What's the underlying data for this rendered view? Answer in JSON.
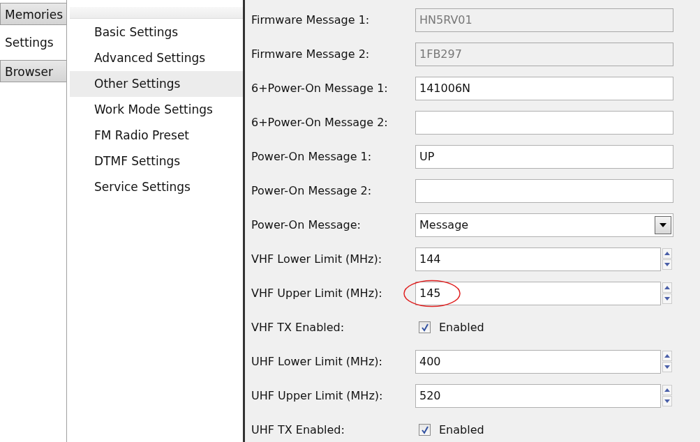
{
  "tabs": [
    {
      "label": "Memories",
      "selected": false
    },
    {
      "label": "Settings",
      "selected": true
    },
    {
      "label": "Browser",
      "selected": false
    }
  ],
  "nav": {
    "items": [
      {
        "label": "Basic Settings",
        "selected": false
      },
      {
        "label": "Advanced Settings",
        "selected": false
      },
      {
        "label": "Other Settings",
        "selected": true
      },
      {
        "label": "Work Mode Settings",
        "selected": false
      },
      {
        "label": "FM Radio Preset",
        "selected": false
      },
      {
        "label": "DTMF Settings",
        "selected": false
      },
      {
        "label": "Service Settings",
        "selected": false
      }
    ]
  },
  "form": {
    "rows": [
      {
        "kind": "text",
        "label": "Firmware Message 1:",
        "value": "HN5RV01",
        "disabled": true
      },
      {
        "kind": "text",
        "label": "Firmware Message 2:",
        "value": "1FB297",
        "disabled": true
      },
      {
        "kind": "text",
        "label": "6+Power-On Message 1:",
        "value": "141006N",
        "disabled": false
      },
      {
        "kind": "text",
        "label": "6+Power-On Message 2:",
        "value": "",
        "disabled": false
      },
      {
        "kind": "text",
        "label": "Power-On Message 1:",
        "value": "UP",
        "disabled": false
      },
      {
        "kind": "text",
        "label": "Power-On Message 2:",
        "value": "",
        "disabled": false
      },
      {
        "kind": "combo",
        "label": "Power-On Message:",
        "value": "Message"
      },
      {
        "kind": "spin",
        "label": "VHF Lower Limit (MHz):",
        "value": "144",
        "circled": false
      },
      {
        "kind": "spin",
        "label": "VHF Upper Limit (MHz):",
        "value": "145",
        "circled": true
      },
      {
        "kind": "check",
        "label": "VHF TX Enabled:",
        "text": "Enabled",
        "checked": true
      },
      {
        "kind": "spin",
        "label": "UHF Lower Limit (MHz):",
        "value": "400",
        "circled": false
      },
      {
        "kind": "spin",
        "label": "UHF Upper Limit (MHz):",
        "value": "520",
        "circled": false
      },
      {
        "kind": "check",
        "label": "UHF TX Enabled:",
        "text": "Enabled",
        "checked": true
      }
    ]
  }
}
